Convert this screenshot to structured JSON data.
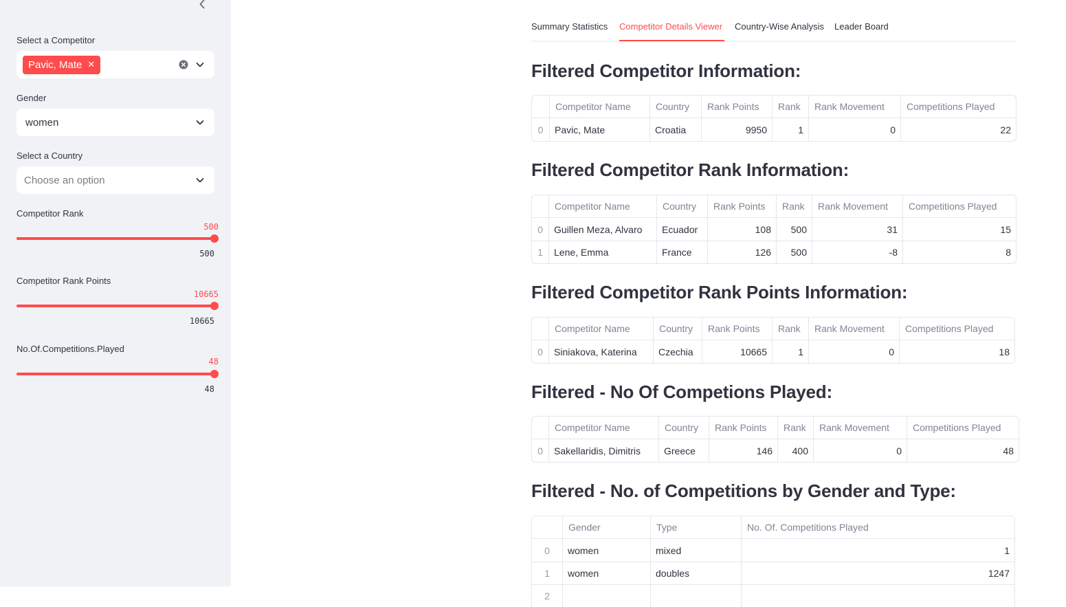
{
  "sidebar": {
    "competitor_label": "Select a Competitor",
    "competitor_tag": "Pavic, Mate",
    "gender_label": "Gender",
    "gender_value": "women",
    "country_label": "Select a Country",
    "country_placeholder": "Choose an option",
    "rank": {
      "label": "Competitor Rank",
      "current": "500",
      "max": "500"
    },
    "rank_points": {
      "label": "Competitor Rank Points",
      "current": "10665",
      "max": "10665"
    },
    "competitions": {
      "label": "No.Of.Competitions.Played",
      "current": "48",
      "max": "48"
    }
  },
  "tabs": [
    "Summary Statistics",
    "Competitor Details Viewer",
    "Country-Wise Analysis",
    "Leader Board"
  ],
  "active_tab": "Competitor Details Viewer",
  "columns": [
    "Competitor Name",
    "Country",
    "Rank Points",
    "Rank",
    "Rank Movement",
    "Competitions Played"
  ],
  "sections": {
    "info": {
      "title": "Filtered Competitor Information:",
      "rows": [
        {
          "idx": "0",
          "name": "Pavic, Mate",
          "country": "Croatia",
          "points": "9950",
          "rank": "1",
          "movement": "0",
          "played": "22"
        }
      ]
    },
    "rank": {
      "title": "Filtered Competitor Rank Information:",
      "rows": [
        {
          "idx": "0",
          "name": "Guillen Meza, Alvaro",
          "country": "Ecuador",
          "points": "108",
          "rank": "500",
          "movement": "31",
          "played": "15"
        },
        {
          "idx": "1",
          "name": "Lene, Emma",
          "country": "France",
          "points": "126",
          "rank": "500",
          "movement": "-8",
          "played": "8"
        }
      ]
    },
    "points": {
      "title": "Filtered Competitor Rank Points Information:",
      "rows": [
        {
          "idx": "0",
          "name": "Siniakova, Katerina",
          "country": "Czechia",
          "points": "10665",
          "rank": "1",
          "movement": "0",
          "played": "18"
        }
      ]
    },
    "played": {
      "title": "Filtered - No Of Competions Played:",
      "rows": [
        {
          "idx": "0",
          "name": "Sakellaridis, Dimitris",
          "country": "Greece",
          "points": "146",
          "rank": "400",
          "movement": "0",
          "played": "48"
        }
      ]
    },
    "gender_type": {
      "title": "Filtered - No. of Competitions by Gender and Type:",
      "columns": [
        "Gender",
        "Type",
        "No. Of. Competitions Played"
      ],
      "rows": [
        {
          "idx": "0",
          "gender": "women",
          "type": "mixed",
          "count": "1"
        },
        {
          "idx": "1",
          "gender": "women",
          "type": "doubles",
          "count": "1247"
        },
        {
          "idx": "2",
          "gender": "",
          "type": "",
          "count": ""
        }
      ]
    }
  },
  "colors": {
    "accent": "#ff4b4b",
    "sidebar_bg": "#f0f2f6",
    "text": "#31333f",
    "muted": "#808495"
  }
}
